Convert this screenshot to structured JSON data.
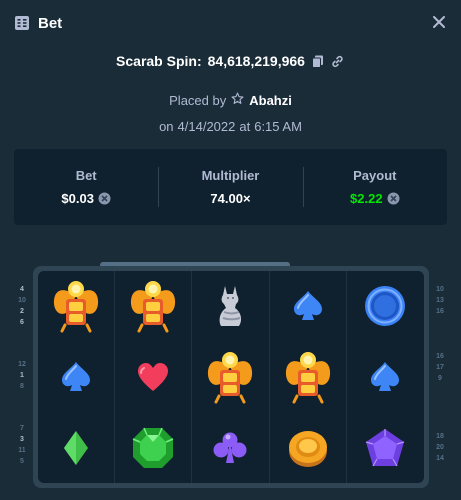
{
  "header": {
    "title": "Bet",
    "icon": "receipt-icon",
    "close_icon": "close-icon"
  },
  "bet": {
    "game_name": "Scarab Spin:",
    "bet_id": "84,618,219,966",
    "placed_by_prefix": "Placed by",
    "user": "Abahzi",
    "date_prefix": "on",
    "date": "4/14/2022",
    "time_prefix": "at",
    "time": "6:15 AM"
  },
  "stats": [
    {
      "label": "Bet",
      "value": "$0.03",
      "coin": true,
      "color": "#ffffff"
    },
    {
      "label": "Multiplier",
      "value": "74.00×",
      "coin": false,
      "color": "#ffffff"
    },
    {
      "label": "Payout",
      "value": "$2.22",
      "coin": true,
      "color": "#00e701"
    }
  ],
  "board": {
    "rows": [
      [
        "scarab",
        "scarab",
        "cat-statue",
        "spade-blue",
        "ring-blue"
      ],
      [
        "spade-blue",
        "heart-red",
        "scarab",
        "scarab",
        "spade-blue"
      ],
      [
        "diamond-green",
        "emerald-green",
        "club-purple",
        "coin-gold",
        "gem-purple"
      ]
    ],
    "left_paylines": [
      [
        "4",
        "10",
        "2",
        "6"
      ],
      [
        "12",
        "1",
        "8"
      ],
      [
        "7",
        "3",
        "11",
        "5"
      ]
    ],
    "right_paylines": [
      [
        "10",
        "13",
        "16"
      ],
      [
        "16",
        "17",
        "9"
      ],
      [
        "18",
        "20",
        "14"
      ]
    ]
  },
  "colors": {
    "background": "#1a2c38",
    "card": "#0f212e",
    "muted_text": "#b1bad3",
    "payout_green": "#00e701"
  }
}
